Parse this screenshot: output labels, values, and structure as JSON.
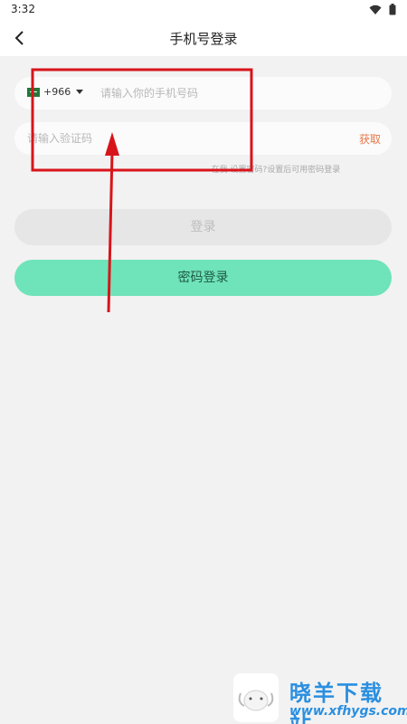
{
  "status_bar": {
    "time": "3:32",
    "icons": [
      "wifi-icon",
      "battery-icon"
    ]
  },
  "header": {
    "title": "手机号登录",
    "back_icon": "chevron-left-icon"
  },
  "phone_field": {
    "country_code": "+966",
    "flag": "saudi-flag-icon",
    "placeholder": "请输入你的手机号码",
    "value": ""
  },
  "code_field": {
    "placeholder": "请输入验证码",
    "value": "",
    "get_code_label": "获取"
  },
  "hint": "在我 设置密码?设置后可用密码登录",
  "buttons": {
    "login": "登录",
    "password_login": "密码登录"
  },
  "watermark": {
    "title": "晓羊下载站",
    "url": "www.xfhygs.com"
  },
  "colors": {
    "accent_green": "#6fe3b9",
    "get_code_orange": "#e8764a",
    "annotation_red": "#d8141b",
    "watermark_blue": "#2a8fe0"
  }
}
